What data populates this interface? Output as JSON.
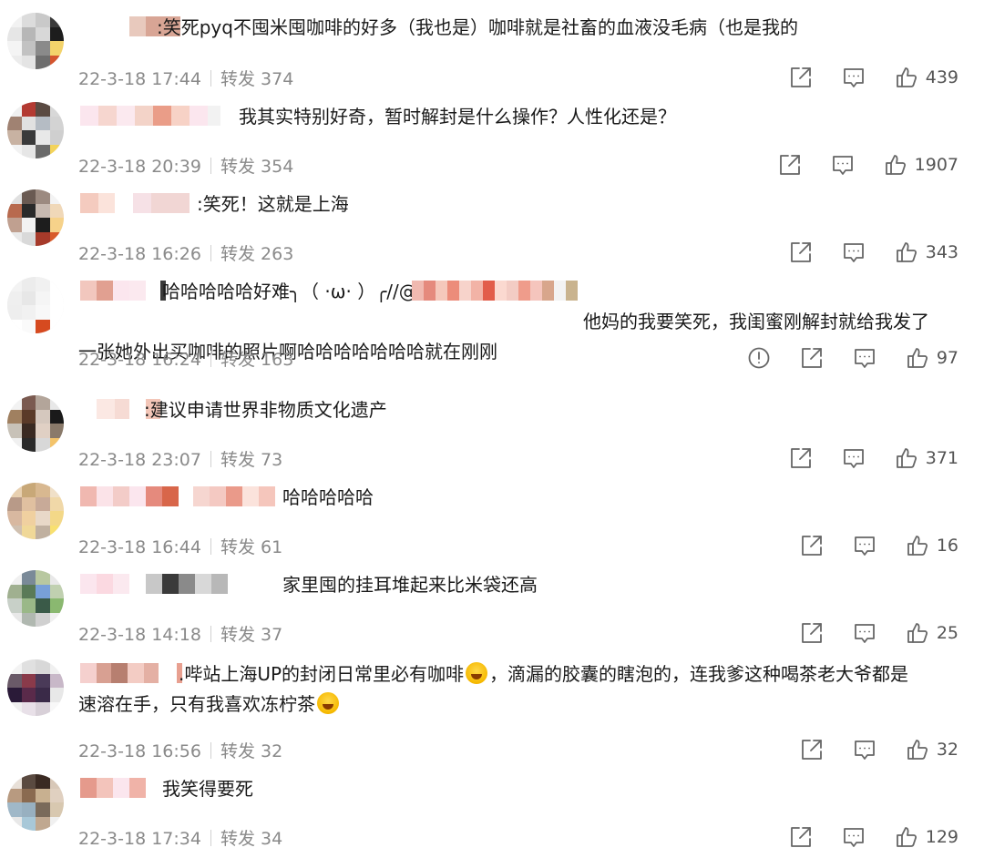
{
  "comments": [
    {
      "text_lines": [
        ":笑死pyq不囤米囤咖啡的好多（我也是）咖啡就是社畜的血液没毛病（也是我的"
      ],
      "date": "22-3-18 17:44",
      "repost_label": "转发",
      "reposts": "374",
      "likes": "439",
      "avatar_colors": [
        "#f2f2f2",
        "#dcdcdc",
        "#c9c9c9",
        "#3a3a3a",
        "#e6e6e6",
        "#b7b7b7",
        "#d8d8d8",
        "#1d1d1d",
        "#f4f4f4",
        "#c2c2c2",
        "#8a8a8a",
        "#f3d36b",
        "#ececec",
        "#e4e4e4",
        "#6e6e6e",
        "#d4552e"
      ],
      "name_colors": [
        "#ffffff",
        "#ffffff",
        "#ffffff",
        "#e8c9bd",
        "#d8a595"
      ]
    },
    {
      "text_lines": [
        "我其实特别好奇，暂时解封是什么操作？人性化还是？"
      ],
      "date": "22-3-18 20:39",
      "repost_label": "转发",
      "reposts": "354",
      "likes": "1907",
      "avatar_colors": [
        "#f0f0f0",
        "#b33a32",
        "#5a4a42",
        "#d8d8d8",
        "#a08272",
        "#e1e1e1",
        "#b5bcc4",
        "#d3d3d3",
        "#c8b2a2",
        "#3a3a3a",
        "#e8e8e8",
        "#cfcfcf",
        "#f2f2f2",
        "#e6e6e6",
        "#6a6a6a",
        "#f3d35a"
      ],
      "name_colors": [
        "#fbe6ee",
        "#f6d6cf",
        "#fbe9ef",
        "#f3d3c8",
        "#ea9d88",
        "#f7d2c6",
        "#fbe6ee",
        "#f2f2f2"
      ]
    },
    {
      "text_lines": [
        ":笑死！这就是上海"
      ],
      "date": "22-3-18 16:26",
      "repost_label": "转发",
      "reposts": "263",
      "likes": "343",
      "avatar_colors": [
        "#e0e0e0",
        "#6a5a52",
        "#9c8a80",
        "#f3f3f3",
        "#b86a4e",
        "#2a2a2a",
        "#c7b9b0",
        "#f0d8b8",
        "#c0a090",
        "#f2f2f2",
        "#1d1d1d",
        "#f6d28a",
        "#e9e9e9",
        "#d9d9d9",
        "#a63a2a",
        "#d85b2a"
      ],
      "name_colors": [
        "#f4cbbf",
        "#fbe3db",
        "#ffffff",
        "#f6e1e6",
        "#f1d6d4"
      ]
    },
    {
      "text_lines": [
        "哈哈哈哈哈好难╮（ ·ω· ）╭//@",
        "他妈的我要笑死，我闺蜜刚解封就给我发了",
        "一张她外出买咖啡的照片啊哈哈哈哈哈哈哈就在刚刚"
      ],
      "date": "22-3-18 16:24",
      "repost_label": "转发",
      "reposts": "163",
      "likes": "97",
      "avatar_colors": [
        "#f3f3f3",
        "#ececec",
        "#f1f1f1",
        "#ffffff",
        "#efefef",
        "#e7e7e7",
        "#f5f5f5",
        "#ffffff",
        "#eeeeee",
        "#f1f1f1",
        "#f8f8f8",
        "#ffffff",
        "#ffffff",
        "#fafafa",
        "#d64a20",
        "#ffffff"
      ],
      "name_colors": [
        "#f2c7be",
        "#e1a091",
        "#fbe6ee",
        "#fbe9ef",
        "#ffffff",
        "#3a3a3a"
      ],
      "mention_colors": [
        "#f0b9b0",
        "#e58a7d",
        "#f5c8bb",
        "#ec8c7a",
        "#f7d3cb",
        "#f2b3a6",
        "#e25d4a",
        "#fbd9d0",
        "#f3ccc4",
        "#ef9c8b",
        "#f5c5bd",
        "#d8a68c",
        "#f3f3f3",
        "#c9b38e"
      ]
    },
    {
      "text_lines": [
        ":建议申请世界非物质文化遗产"
      ],
      "date": "22-3-18 23:07",
      "repost_label": "转发",
      "reposts": "73",
      "likes": "371",
      "avatar_colors": [
        "#f2f2f2",
        "#7a5a50",
        "#b3a59a",
        "#e8e8e8",
        "#a08060",
        "#5a3a28",
        "#d5c8be",
        "#1a1a1a",
        "#c8c2b8",
        "#3a2a22",
        "#e0d0c4",
        "#8a7a6a",
        "#f0f0f0",
        "#2a2a2a",
        "#d8d8d8",
        "#f3c36a"
      ],
      "name_colors": [
        "#ffffff",
        "#fbe8e3",
        "#f6dbd4",
        "#ffffff",
        "#f3c6b8"
      ]
    },
    {
      "text_lines": [
        "哈哈哈哈哈"
      ],
      "date": "22-3-18 16:44",
      "repost_label": "转发",
      "reposts": "61",
      "likes": "16",
      "avatar_colors": [
        "#e8d0b0",
        "#c8a878",
        "#d8b890",
        "#f0e0c8",
        "#b89a88",
        "#e0c0a0",
        "#c8aa98",
        "#f0d8a8",
        "#d8b8a0",
        "#f0d0a0",
        "#e8d8c8",
        "#f3d888",
        "#d0c0b0",
        "#f0d898",
        "#c0b0a0",
        "#f8e070"
      ],
      "name_colors": [
        "#f0b8b0",
        "#fbe3e8",
        "#f3ccc8",
        "#fbe6ee",
        "#e58a7d",
        "#d8664a",
        "#ffffff",
        "#f6d6d0",
        "#f4c9c2",
        "#ea9a8a",
        "#fbe3dc",
        "#f5c6bc"
      ]
    },
    {
      "text_lines": [
        "家里囤的挂耳堆起来比米袋还高"
      ],
      "date": "22-3-18 14:18",
      "repost_label": "转发",
      "reposts": "37",
      "likes": "25",
      "avatar_colors": [
        "#f0f0f0",
        "#7a8a98",
        "#b8c8a0",
        "#e8e8e8",
        "#a0b090",
        "#5a7a58",
        "#78a0d8",
        "#c0d0b0",
        "#c8d0c8",
        "#9ab888",
        "#3a5a48",
        "#8ab870",
        "#e8e8e8",
        "#b0b8b0",
        "#d0d0d0",
        "#f0f0f0"
      ],
      "name_colors": [
        "#fbe6ee",
        "#fbd9e1",
        "#fbe9ef",
        "#ffffff",
        "#c8c8c8",
        "#3a3a3a",
        "#8a8a8a",
        "#d8d8d8",
        "#b8b8b8"
      ]
    },
    {
      "text_lines": [
        ".哔站上海UP的封闭日常里必有咖啡@@，滴漏的胶囊的瞎泡的，连我爹这种喝茶老大爷都是",
        "速溶在手，只有我喜欢冻柠茶@@"
      ],
      "date": "22-3-18 16:56",
      "repost_label": "转发",
      "reposts": "32",
      "likes": "32",
      "avatar_colors": [
        "#f3f3f3",
        "#e0e0e0",
        "#d8d8d8",
        "#f0f0f0",
        "#6a5a68",
        "#8a3a4a",
        "#4a3a58",
        "#c8b8c8",
        "#2a1a38",
        "#5a2a4a",
        "#3a2a48",
        "#e8e8e8",
        "#f0f0f0",
        "#e8e0e8",
        "#d8d0d8",
        "#f8f8f8"
      ],
      "name_colors": [
        "#f5d0ce",
        "#d8a092",
        "#b77f70",
        "#f3ccc4",
        "#e4b0a4",
        "#ffffff",
        "#e8a090"
      ]
    },
    {
      "text_lines": [
        "我笑得要死"
      ],
      "date": "22-3-18 17:34",
      "repost_label": "转发",
      "reposts": "34",
      "likes": "129",
      "avatar_colors": [
        "#e8e0d8",
        "#5a4a40",
        "#3a2a22",
        "#d8c8b8",
        "#b89a80",
        "#8a6a50",
        "#c8b090",
        "#e0d0c0",
        "#a0b8c8",
        "#98b0c0",
        "#7a6a5a",
        "#d8c8b0",
        "#e8e8e8",
        "#a8c8d8",
        "#c0a890",
        "#f0f0f0"
      ],
      "name_colors": [
        "#e59a8c",
        "#f3c4bb",
        "#fbe6ee",
        "#f0b3a8",
        "#ffffff"
      ]
    }
  ]
}
